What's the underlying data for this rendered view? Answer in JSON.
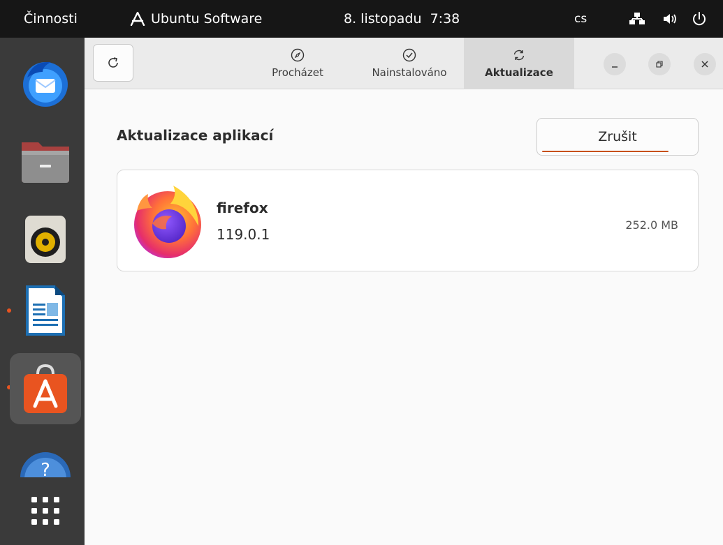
{
  "topbar": {
    "activities": "Činnosti",
    "app_name": "Ubuntu Software",
    "clock": "8. listopadu  7:38",
    "language": "cs",
    "icons": [
      "network-icon",
      "volume-icon",
      "power-icon"
    ]
  },
  "dock": {
    "items": [
      {
        "name": "Thunderbird",
        "icon": "thunderbird-icon"
      },
      {
        "name": "Files",
        "icon": "files-icon"
      },
      {
        "name": "Rhythmbox",
        "icon": "rhythmbox-icon"
      },
      {
        "name": "LibreOffice Writer",
        "icon": "writer-icon",
        "running": true
      },
      {
        "name": "Ubuntu Software",
        "icon": "software-icon",
        "running": true,
        "active": true
      },
      {
        "name": "Help",
        "icon": "help-icon"
      },
      {
        "name": "Show Applications",
        "icon": "app-grid-icon"
      }
    ]
  },
  "headerbar": {
    "tabs": [
      {
        "label": "Procházet",
        "icon": "compass-icon"
      },
      {
        "label": "Nainstalováno",
        "icon": "check-circle-icon"
      },
      {
        "label": "Aktualizace",
        "icon": "refresh-icon",
        "active": true
      }
    ]
  },
  "main": {
    "section_title": "Aktualizace aplikací",
    "cancel_label": "Zrušit",
    "updates": [
      {
        "name": "firefox",
        "version": "119.0.1",
        "size": "252.0 MB",
        "icon": "firefox-icon"
      }
    ]
  },
  "colors": {
    "accent": "#e95420",
    "topbar": "#161616",
    "dock": "#3a3a3a"
  }
}
